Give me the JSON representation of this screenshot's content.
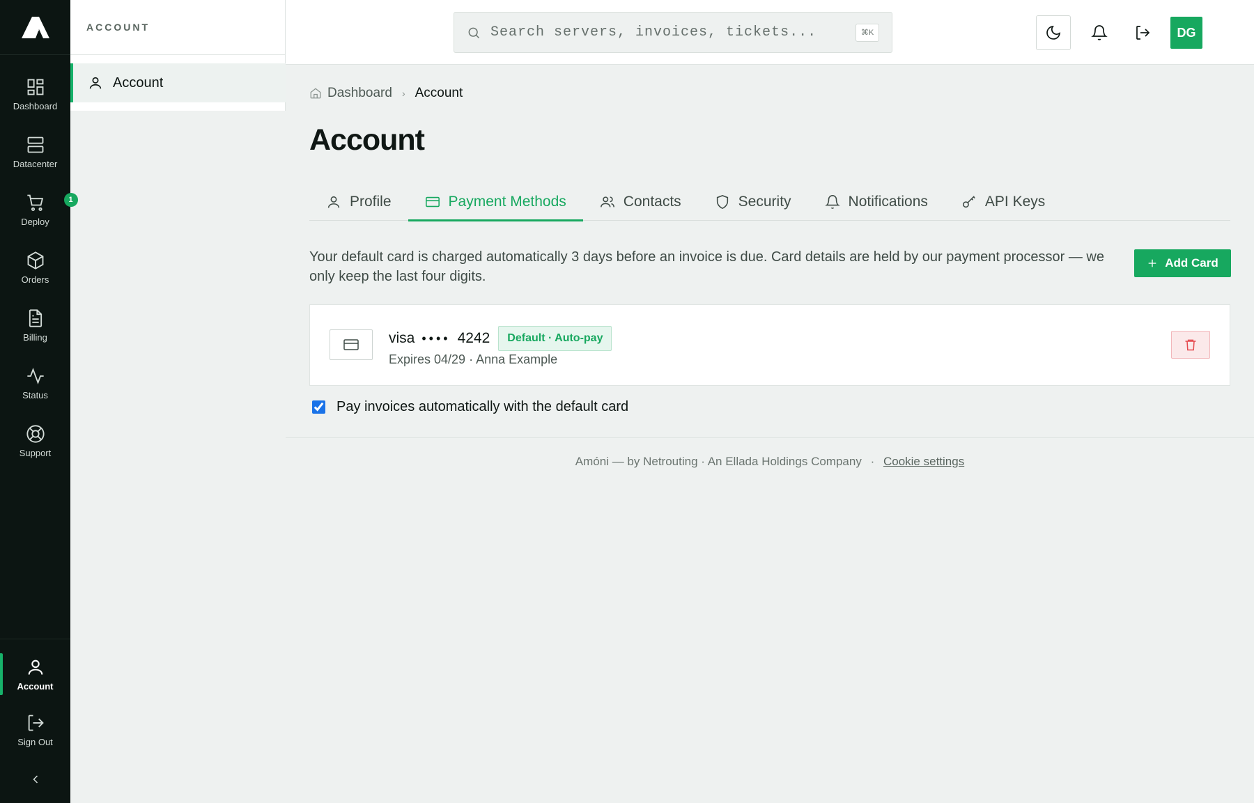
{
  "rail": {
    "items": [
      {
        "label": "Dashboard",
        "icon": "dashboard-grid-icon"
      },
      {
        "label": "Datacenter",
        "icon": "server-icon"
      },
      {
        "label": "Deploy",
        "icon": "cart-icon",
        "badge": "1"
      },
      {
        "label": "Orders",
        "icon": "package-icon"
      },
      {
        "label": "Billing",
        "icon": "file-text-icon"
      },
      {
        "label": "Status",
        "icon": "activity-icon"
      },
      {
        "label": "Support",
        "icon": "lifebuoy-icon"
      }
    ],
    "bottom": [
      {
        "label": "Account",
        "icon": "user-icon",
        "active": true
      },
      {
        "label": "Sign Out",
        "icon": "logout-icon"
      }
    ],
    "collapse_icon": "chevron-left-icon"
  },
  "subnav": {
    "title": "ACCOUNT",
    "item": "Account"
  },
  "topbar": {
    "search_placeholder": "Search servers, invoices, tickets...",
    "shortcut": "⌘K",
    "avatar": "DG"
  },
  "breadcrumb": {
    "home": "Dashboard",
    "current": "Account"
  },
  "page_title": "Account",
  "tabs": [
    {
      "label": "Profile",
      "icon": "user-icon"
    },
    {
      "label": "Payment Methods",
      "icon": "credit-card-icon",
      "active": true
    },
    {
      "label": "Contacts",
      "icon": "users-icon"
    },
    {
      "label": "Security",
      "icon": "shield-icon"
    },
    {
      "label": "Notifications",
      "icon": "bell-icon"
    },
    {
      "label": "API Keys",
      "icon": "key-icon"
    }
  ],
  "payment": {
    "info": "Your default card is charged automatically 3 days before an invoice is due. Card details are held by our payment processor — we only keep the last four digits.",
    "add_button": "Add Card",
    "card": {
      "brand": "visa",
      "dots": "••••",
      "last4": "4242",
      "badge": "Default · Auto-pay",
      "details": "Expires 04/29 · Anna Example"
    },
    "autopay_label": "Pay invoices automatically with the default card",
    "autopay_checked": true
  },
  "footer": {
    "text": "Amóni — by Netrouting · An Ellada Holdings Company",
    "sep": "·",
    "link": "Cookie settings"
  },
  "colors": {
    "accent": "#17a85f",
    "rail_bg": "#0c1512",
    "danger": "#e5484d"
  }
}
